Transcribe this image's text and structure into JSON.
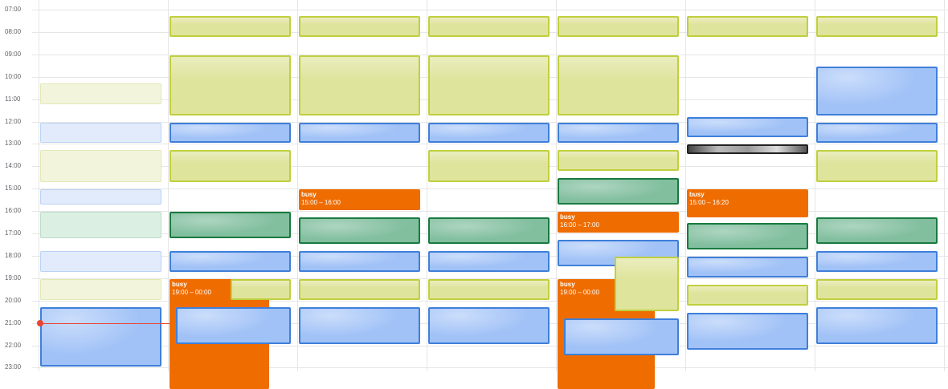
{
  "app": "week-calendar-view",
  "colors": {
    "lime": "#dfe49c",
    "blue": "#a1c2f7",
    "green": "#82bf9f",
    "orange": "#ef6c00",
    "now": "#ea4335",
    "grid": "#e6e6e6"
  },
  "hours": [
    "07:00",
    "08:00",
    "09:00",
    "10:00",
    "11:00",
    "12:00",
    "13:00",
    "14:00",
    "15:00",
    "16:00",
    "17:00",
    "18:00",
    "19:00",
    "20:00",
    "21:00",
    "22:00",
    "23:00"
  ],
  "now_time": "21:00",
  "events": [
    {
      "day": 0,
      "start": "10:15",
      "end": "11:15",
      "color": "lime-faded"
    },
    {
      "day": 0,
      "start": "12:00",
      "end": "13:00",
      "color": "blue-faded"
    },
    {
      "day": 0,
      "start": "13:15",
      "end": "14:45",
      "color": "lime-faded"
    },
    {
      "day": 0,
      "start": "15:00",
      "end": "15:45",
      "color": "blue-faded"
    },
    {
      "day": 0,
      "start": "16:00",
      "end": "17:15",
      "color": "green-faded"
    },
    {
      "day": 0,
      "start": "17:45",
      "end": "18:45",
      "color": "blue-faded"
    },
    {
      "day": 0,
      "start": "19:00",
      "end": "20:00",
      "color": "lime-faded"
    },
    {
      "day": 0,
      "start": "20:15",
      "end": "23:00",
      "color": "blue"
    },
    {
      "day": 1,
      "start": "07:15",
      "end": "08:15",
      "color": "lime"
    },
    {
      "day": 1,
      "start": "09:00",
      "end": "11:45",
      "color": "lime"
    },
    {
      "day": 1,
      "start": "12:00",
      "end": "13:00",
      "color": "blue"
    },
    {
      "day": 1,
      "start": "13:15",
      "end": "14:45",
      "color": "lime"
    },
    {
      "day": 1,
      "start": "16:00",
      "end": "17:15",
      "color": "green"
    },
    {
      "day": 1,
      "start": "17:45",
      "end": "18:45",
      "color": "blue"
    },
    {
      "day": 1,
      "start": "19:00",
      "end": "00:00",
      "color": "orange",
      "title": "busy",
      "range": "19:00 – 00:00",
      "width_frac": 0.82
    },
    {
      "day": 1,
      "start": "19:00",
      "end": "20:00",
      "color": "lime",
      "offset_frac": 0.5,
      "width_frac": 0.5
    },
    {
      "day": 1,
      "start": "20:15",
      "end": "22:00",
      "color": "blue",
      "offset_frac": 0.05,
      "width_frac": 0.95
    },
    {
      "day": 2,
      "start": "07:15",
      "end": "08:15",
      "color": "lime"
    },
    {
      "day": 2,
      "start": "09:00",
      "end": "11:45",
      "color": "lime"
    },
    {
      "day": 2,
      "start": "12:00",
      "end": "13:00",
      "color": "blue"
    },
    {
      "day": 2,
      "start": "15:00",
      "end": "16:00",
      "color": "orange",
      "title": "busy",
      "range": "15:00 – 16:00"
    },
    {
      "day": 2,
      "start": "16:15",
      "end": "17:30",
      "color": "green"
    },
    {
      "day": 2,
      "start": "17:45",
      "end": "18:45",
      "color": "blue"
    },
    {
      "day": 2,
      "start": "19:00",
      "end": "20:00",
      "color": "lime"
    },
    {
      "day": 2,
      "start": "20:15",
      "end": "22:00",
      "color": "blue"
    },
    {
      "day": 3,
      "start": "07:15",
      "end": "08:15",
      "color": "lime"
    },
    {
      "day": 3,
      "start": "09:00",
      "end": "11:45",
      "color": "lime"
    },
    {
      "day": 3,
      "start": "12:00",
      "end": "13:00",
      "color": "blue"
    },
    {
      "day": 3,
      "start": "13:15",
      "end": "14:45",
      "color": "lime"
    },
    {
      "day": 3,
      "start": "16:15",
      "end": "17:30",
      "color": "green"
    },
    {
      "day": 3,
      "start": "17:45",
      "end": "18:45",
      "color": "blue"
    },
    {
      "day": 3,
      "start": "19:00",
      "end": "20:00",
      "color": "lime"
    },
    {
      "day": 3,
      "start": "20:15",
      "end": "22:00",
      "color": "blue"
    },
    {
      "day": 4,
      "start": "07:15",
      "end": "08:15",
      "color": "lime"
    },
    {
      "day": 4,
      "start": "09:00",
      "end": "11:45",
      "color": "lime"
    },
    {
      "day": 4,
      "start": "12:00",
      "end": "13:00",
      "color": "blue"
    },
    {
      "day": 4,
      "start": "13:15",
      "end": "14:15",
      "color": "lime"
    },
    {
      "day": 4,
      "start": "14:30",
      "end": "15:45",
      "color": "green"
    },
    {
      "day": 4,
      "start": "16:00",
      "end": "17:00",
      "color": "orange",
      "title": "busy",
      "range": "16:00 – 17:00"
    },
    {
      "day": 4,
      "start": "17:15",
      "end": "18:30",
      "color": "blue"
    },
    {
      "day": 4,
      "start": "19:00",
      "end": "00:00",
      "color": "orange",
      "title": "busy",
      "range": "19:00 – 00:00",
      "width_frac": 0.8
    },
    {
      "day": 4,
      "start": "18:00",
      "end": "20:30",
      "color": "lime",
      "offset_frac": 0.47,
      "width_frac": 0.53
    },
    {
      "day": 4,
      "start": "20:45",
      "end": "22:30",
      "color": "blue",
      "offset_frac": 0.05,
      "width_frac": 0.95
    },
    {
      "day": 5,
      "start": "07:15",
      "end": "08:15",
      "color": "lime"
    },
    {
      "day": 5,
      "start": "11:45",
      "end": "12:45",
      "color": "blue"
    },
    {
      "day": 5,
      "start": "13:00",
      "end": "13:30",
      "color": "gray"
    },
    {
      "day": 5,
      "start": "15:00",
      "end": "16:20",
      "color": "orange",
      "title": "busy",
      "range": "15:00 – 16:20"
    },
    {
      "day": 5,
      "start": "16:30",
      "end": "17:45",
      "color": "green"
    },
    {
      "day": 5,
      "start": "18:00",
      "end": "19:00",
      "color": "blue"
    },
    {
      "day": 5,
      "start": "19:15",
      "end": "20:15",
      "color": "lime"
    },
    {
      "day": 5,
      "start": "20:30",
      "end": "22:15",
      "color": "blue"
    },
    {
      "day": 6,
      "start": "07:15",
      "end": "08:15",
      "color": "lime"
    },
    {
      "day": 6,
      "start": "09:30",
      "end": "11:45",
      "color": "blue"
    },
    {
      "day": 6,
      "start": "12:00",
      "end": "13:00",
      "color": "blue"
    },
    {
      "day": 6,
      "start": "13:15",
      "end": "14:45",
      "color": "lime"
    },
    {
      "day": 6,
      "start": "16:15",
      "end": "17:30",
      "color": "green"
    },
    {
      "day": 6,
      "start": "17:45",
      "end": "18:45",
      "color": "blue"
    },
    {
      "day": 6,
      "start": "19:00",
      "end": "20:00",
      "color": "lime"
    },
    {
      "day": 6,
      "start": "20:15",
      "end": "22:00",
      "color": "blue"
    }
  ]
}
